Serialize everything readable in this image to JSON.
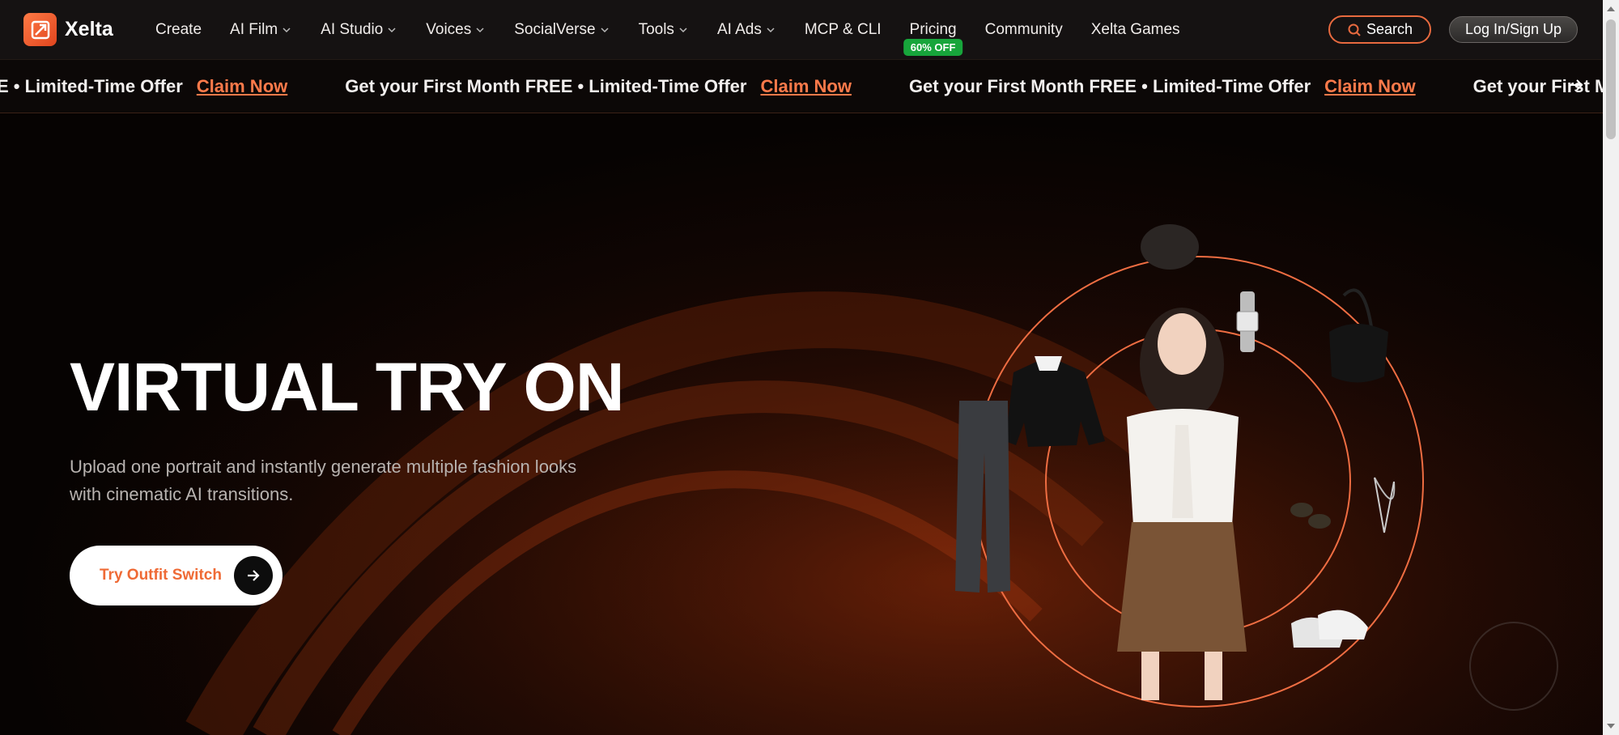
{
  "brand": {
    "name": "Xelta"
  },
  "nav": {
    "items": [
      {
        "label": "Create",
        "dropdown": false
      },
      {
        "label": "AI Film",
        "dropdown": true
      },
      {
        "label": "AI Studio",
        "dropdown": true
      },
      {
        "label": "Voices",
        "dropdown": true
      },
      {
        "label": "SocialVerse",
        "dropdown": true
      },
      {
        "label": "Tools",
        "dropdown": true
      },
      {
        "label": "AI Ads",
        "dropdown": true
      },
      {
        "label": "MCP & CLI",
        "dropdown": false
      },
      {
        "label": "Pricing",
        "dropdown": false,
        "badge": "60% OFF"
      },
      {
        "label": "Community",
        "dropdown": false
      },
      {
        "label": "Xelta Games",
        "dropdown": false
      }
    ],
    "search_label": "Search",
    "login_label": "Log In/Sign Up"
  },
  "promo": {
    "lead_fragment": "E • Limited-Time Offer",
    "text": "Get your First Month FREE • Limited-Time Offer",
    "trail_fragment": "Get your First Month FREE",
    "claim_label": "Claim Now"
  },
  "hero": {
    "title": "VIRTUAL TRY ON",
    "subtitle": "Upload one portrait and instantly generate multiple fashion looks with cinematic AI transitions.",
    "cta_label": "Try Outfit Switch"
  },
  "colors": {
    "accent": "#ef6a35",
    "badge_green": "#17a53b",
    "nav_bg": "#151212"
  },
  "icons": [
    "logo-mark-icon",
    "chevron-down-icon",
    "search-icon",
    "arrow-right-icon"
  ]
}
